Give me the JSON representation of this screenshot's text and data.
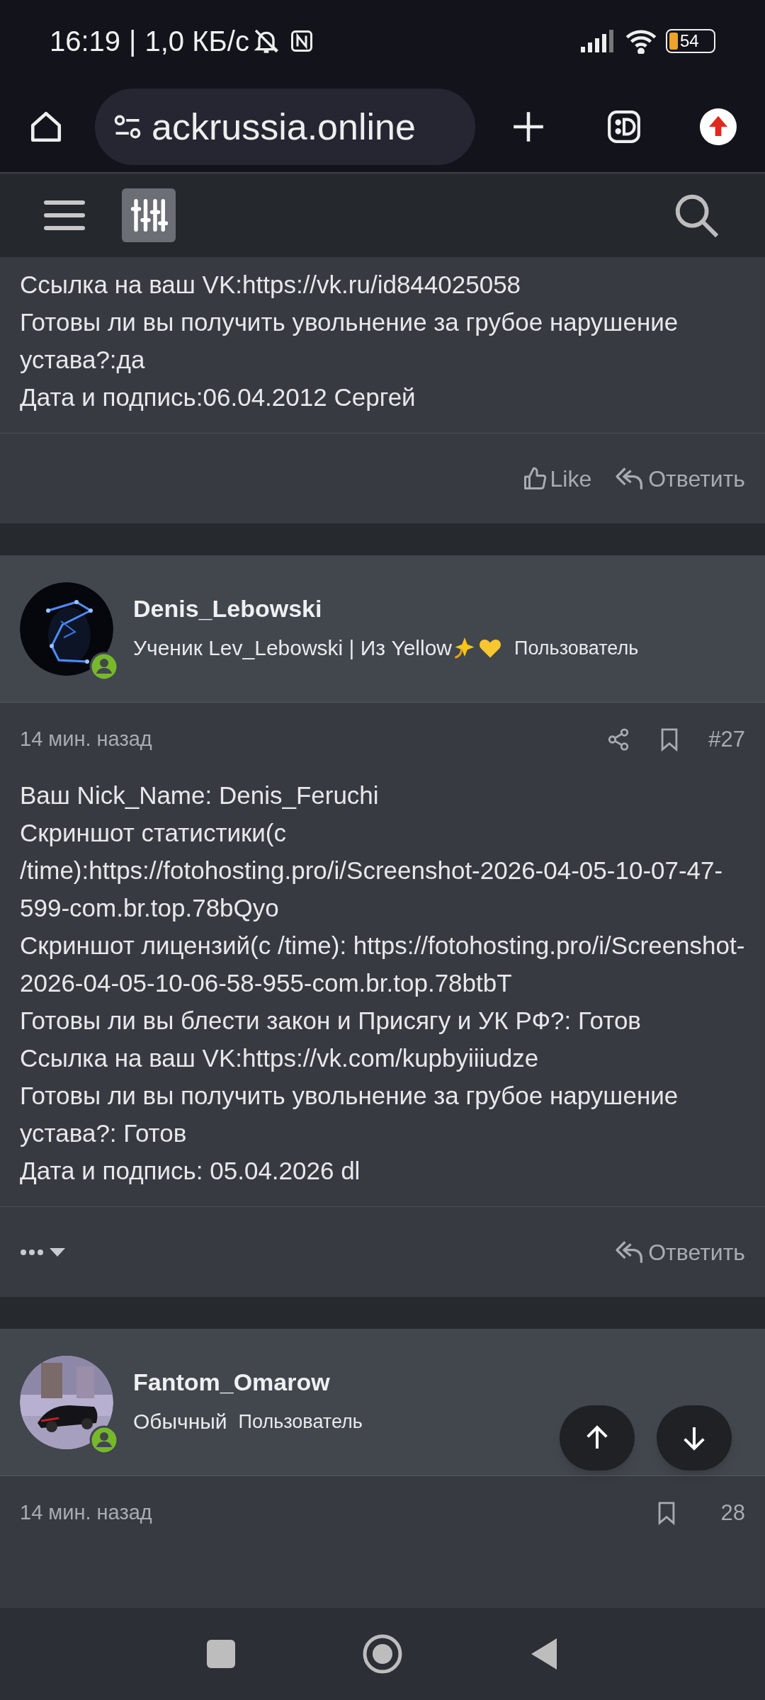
{
  "status_bar": {
    "time": "16:19",
    "separator": "|",
    "speed": "1,0 КБ/с",
    "battery": "54"
  },
  "browser": {
    "url": "ackrussia.online"
  },
  "posts": [
    {
      "body": [
        "Ссылка на ваш VK:https://vk.ru/id844025058",
        "Готовы ли вы получить увольнение за грубое нарушение устава?:да",
        "Дата и подпись:06.04.2012 Сергей"
      ],
      "footer": {
        "more": false,
        "actions": [
          {
            "kind": "like",
            "label": "Like"
          },
          {
            "kind": "reply",
            "label": "Ответить"
          }
        ]
      }
    },
    {
      "author": {
        "name": "Denis_Lebowski",
        "title": "Ученик Lev_Lebowski | Из Yellow",
        "role": "Пользователь",
        "online": true,
        "emoji": true
      },
      "time": "14 мин. назад",
      "number": "#27",
      "body": [
        "Ваш Nick_Name: Denis_Feruchi",
        "Скриншот статистики(с /time):https://fotohosting.pro/i/Screenshot-2026-04-05-10-07-47-599-com.br.top.78bQyo",
        "Скриншот лицензий(с /time): https://fotohosting.pro/i/Screenshot-2026-04-05-10-06-58-955-com.br.top.78btbT",
        "Готовы ли вы блести закон и Присягу и УК РФ?: Готов",
        "Ссылка на ваш VK:https://vk.com/kupbyiiiudze",
        "Готовы ли вы получить увольнение за грубое нарушение устава?: Готов",
        "Дата и подпись: 05.04.2026 dl"
      ],
      "footer": {
        "more": true,
        "actions": [
          {
            "kind": "reply",
            "label": "Ответить"
          }
        ]
      }
    },
    {
      "author": {
        "name": "Fantom_Omarow",
        "title": "Обычный",
        "role": "Пользователь",
        "online": true,
        "emoji": false
      },
      "time": "14 мин. назад",
      "number": "28"
    }
  ]
}
